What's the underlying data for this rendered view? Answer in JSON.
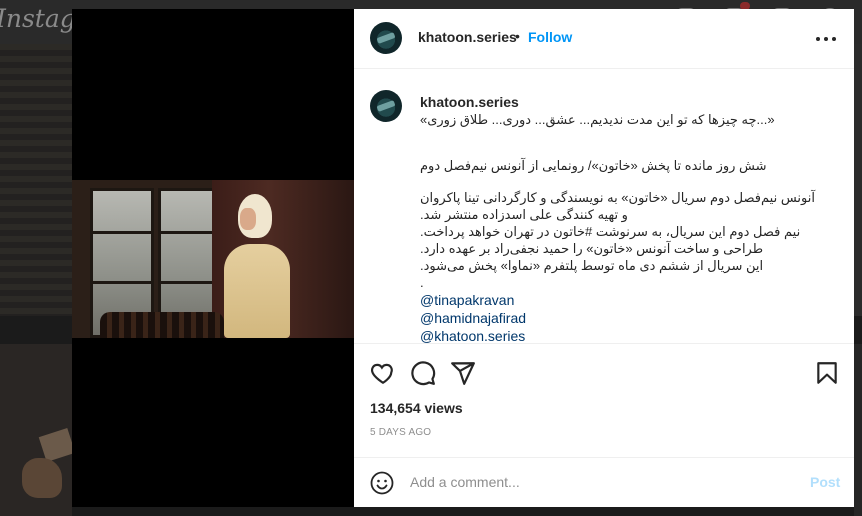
{
  "background": {
    "logo": "Instagram"
  },
  "post": {
    "username": "khatoon.series",
    "header_dot": "•",
    "follow_label": "Follow",
    "caption_lines": [
      "«...چه چیزها که تو این مدت ندیدیم... عشق... دوری... طلاق زوری»",
      "",
      "شش روز مانده تا پخش «خاتون»/ رونمایی از آنونس نیم‌فصل دوم",
      "",
      "آنونس نیم‌فصل دوم سریال «خاتون» به نویسندگی و کارگردانی تینا پاکروان",
      "و تهیه کنندگی علی اسدزاده منتشر شد.",
      "نیم فصل دوم این سریال، به سرنوشت #خاتون در تهران خواهد پرداخت.",
      "طراحی و ساخت آنونس «خاتون» را حمید نجفی‌راد بر عهده دارد.",
      "این سریال از ششم دی ماه توسط پلتفرم «نماوا» پخش می‌شود.",
      "."
    ],
    "mentions": [
      "@tinapakravan",
      "@hamidnajafirad",
      "@khatoon.series"
    ],
    "views": "134,654 views",
    "date": "5 DAYS AGO",
    "comment_placeholder": "Add a comment...",
    "post_label": "Post"
  },
  "colors": {
    "follow": "#0095f6",
    "post_disabled": "#b2dffc",
    "mention": "#00376b"
  },
  "icons": [
    "heart-icon",
    "comment-icon",
    "share-icon",
    "bookmark-icon",
    "emoji-icon",
    "more-icon"
  ]
}
